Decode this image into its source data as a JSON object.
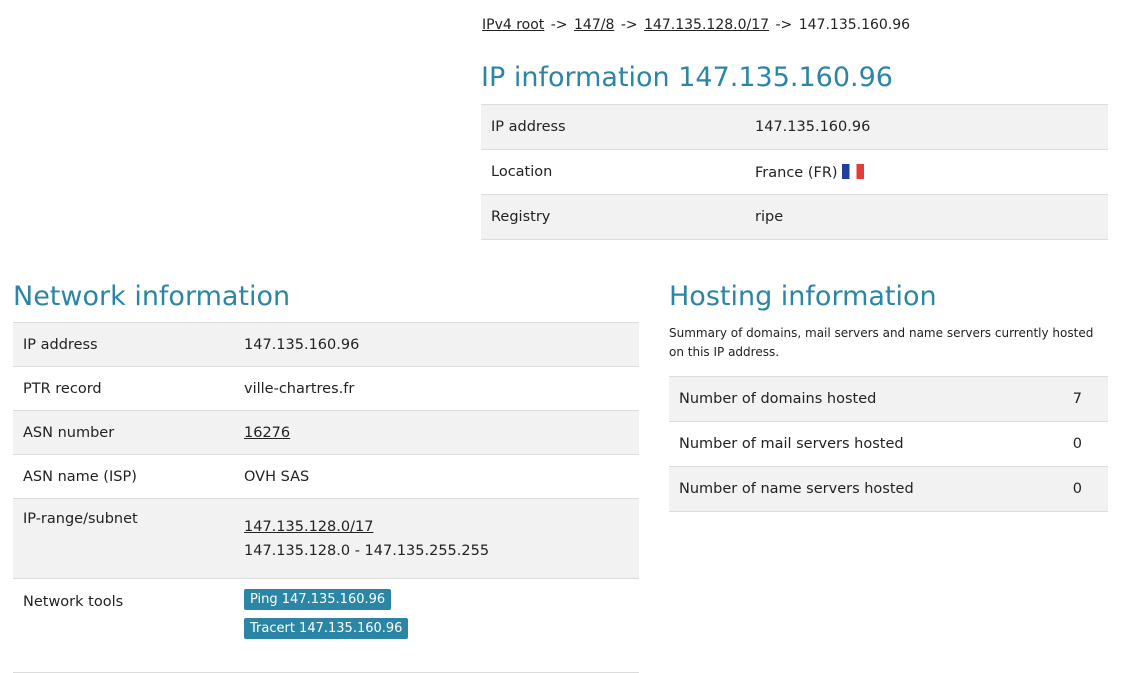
{
  "breadcrumb": {
    "items": [
      {
        "label": "IPv4 root",
        "link": true
      },
      {
        "label": "147/8",
        "link": true
      },
      {
        "label": "147.135.128.0/17",
        "link": true
      },
      {
        "label": "147.135.160.96",
        "link": false
      }
    ],
    "separator": "->"
  },
  "ip_info": {
    "title": "IP information 147.135.160.96",
    "rows": [
      {
        "key": "IP address",
        "value": "147.135.160.96"
      },
      {
        "key": "Location",
        "value": "France (FR)"
      },
      {
        "key": "Registry",
        "value": "ripe"
      }
    ],
    "flag_colors": [
      "#1f3fa0",
      "#ffffff",
      "#e83a3a"
    ]
  },
  "network": {
    "title": "Network information",
    "rows": [
      {
        "key": "IP address",
        "value": "147.135.160.96"
      },
      {
        "key": "PTR record",
        "value": "ville-chartres.fr"
      },
      {
        "key": "ASN number",
        "value": "16276"
      },
      {
        "key": "ASN name (ISP)",
        "value": "OVH SAS"
      },
      {
        "key": "IP-range/subnet",
        "value": "147.135.128.0/17",
        "value2": "147.135.128.0 - 147.135.255.255"
      },
      {
        "key": "Network tools",
        "buttons": [
          "Ping 147.135.160.96",
          "Tracert 147.135.160.96"
        ]
      }
    ]
  },
  "hosting": {
    "title": "Hosting information",
    "description": "Summary of domains, mail servers and name servers currently hosted on this IP address.",
    "rows": [
      {
        "key": "Number of domains hosted",
        "value": "7"
      },
      {
        "key": "Number of mail servers hosted",
        "value": "0"
      },
      {
        "key": "Number of name servers hosted",
        "value": "0"
      }
    ]
  },
  "colors": {
    "accent": "#2b86a5",
    "row_alt": "#f2f2f2"
  }
}
